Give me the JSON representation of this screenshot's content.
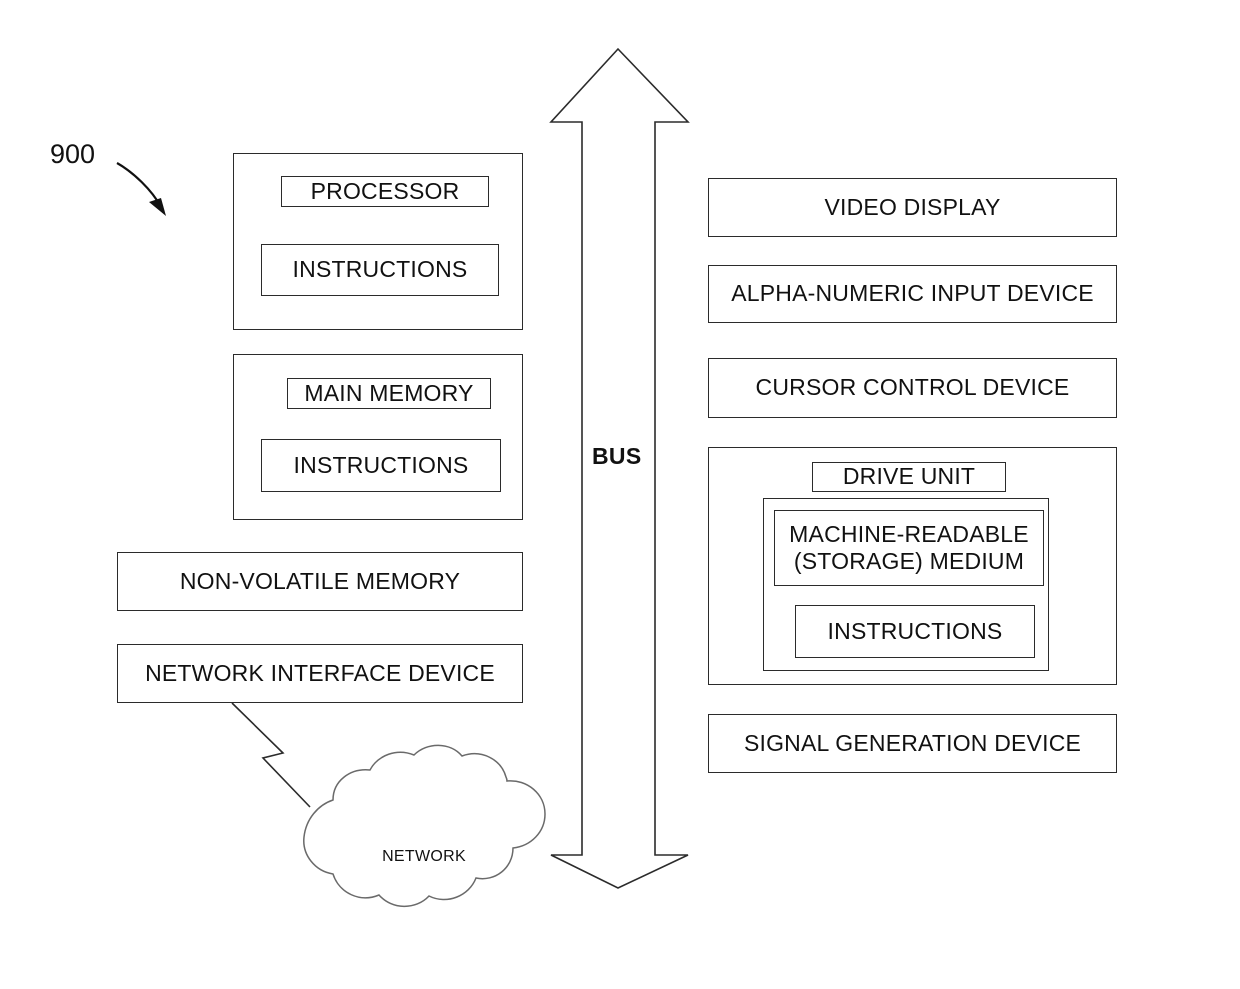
{
  "figure": {
    "reference_number": "900",
    "bus_label": "BUS",
    "network_cloud_label": "NETWORK"
  },
  "left_column": {
    "processor_unit": {
      "title": "PROCESSOR",
      "inner": "INSTRUCTIONS"
    },
    "main_memory_unit": {
      "title": "MAIN MEMORY",
      "inner": "INSTRUCTIONS"
    },
    "non_volatile_memory": "NON-VOLATILE MEMORY",
    "network_interface_device": "NETWORK INTERFACE DEVICE"
  },
  "right_column": {
    "video_display": "VIDEO DISPLAY",
    "alpha_numeric_input_device": "ALPHA-NUMERIC INPUT DEVICE",
    "cursor_control_device": "CURSOR CONTROL DEVICE",
    "drive_unit": {
      "title": "DRIVE UNIT",
      "machine_readable_medium": "MACHINE-READABLE\n(STORAGE) MEDIUM",
      "instructions": "INSTRUCTIONS"
    },
    "signal_generation_device": "SIGNAL GENERATION DEVICE"
  },
  "colors": {
    "stroke": "#2b2b2b",
    "text": "#111111",
    "background": "#ffffff"
  }
}
